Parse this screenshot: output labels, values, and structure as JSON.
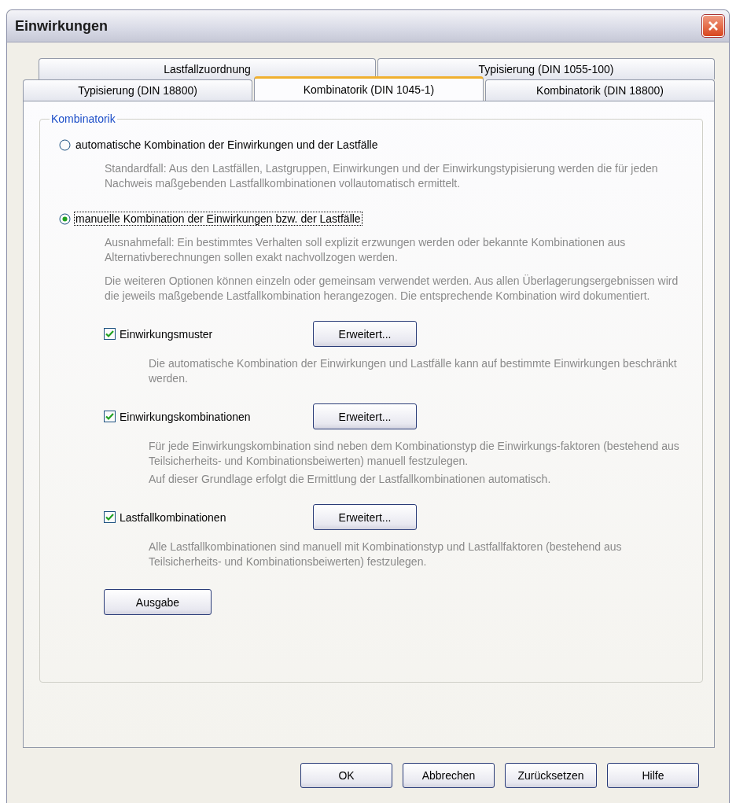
{
  "window": {
    "title": "Einwirkungen"
  },
  "tabs": [
    [
      {
        "label": "Lastfallzuordnung",
        "selected": false
      },
      {
        "label": "Typisierung (DIN 1055-100)",
        "selected": false
      }
    ],
    [
      {
        "label": "Typisierung (DIN 18800)",
        "selected": false
      },
      {
        "label": "Kombinatorik (DIN 1045-1)",
        "selected": true
      },
      {
        "label": "Kombinatorik (DIN 18800)",
        "selected": false
      }
    ]
  ],
  "group": {
    "title": "Kombinatorik",
    "options": [
      {
        "label": "automatische Kombination der Einwirkungen und der Lastfälle",
        "selected": false,
        "focused": false,
        "description": [
          "Standardfall: Aus den Lastfällen, Lastgruppen, Einwirkungen und der Einwirkungstypisierung werden die für jeden Nachweis maßgebenden Lastfallkombinationen vollautomatisch ermittelt."
        ]
      },
      {
        "label": "manuelle Kombination der Einwirkungen bzw. der Lastfälle",
        "selected": true,
        "focused": true,
        "description": [
          "Ausnahmefall: Ein bestimmtes Verhalten soll explizit erzwungen werden oder bekannte Kombinationen aus Alternativberechnungen sollen exakt nachvollzogen werden.",
          "Die weiteren Optionen können einzeln oder gemeinsam verwendet werden. Aus allen Überlagerungsergebnissen wird die jeweils maßgebende Lastfallkombination herangezogen. Die entsprechende Kombination wird dokumentiert."
        ],
        "checkboxes": [
          {
            "label": "Einwirkungsmuster",
            "checked": true,
            "button": "Erweitert...",
            "description": [
              "Die automatische Kombination der Einwirkungen und Lastfälle kann auf bestimmte Einwirkungen beschränkt werden."
            ]
          },
          {
            "label": "Einwirkungskombinationen",
            "checked": true,
            "button": "Erweitert...",
            "description": [
              "Für jede Einwirkungskombination sind neben dem Kombinationstyp die Einwirkungs-faktoren (bestehend aus Teilsicherheits- und Kombinationsbeiwerten) manuell festzulegen.",
              "Auf dieser Grundlage erfolgt die Ermittlung der Lastfallkombinationen automatisch."
            ]
          },
          {
            "label": "Lastfallkombinationen",
            "checked": true,
            "button": "Erweitert...",
            "description": [
              "Alle Lastfallkombinationen sind manuell mit Kombinationstyp und Lastfallfaktoren (bestehend aus Teilsicherheits- und Kombinationsbeiwerten) festzulegen."
            ]
          }
        ],
        "output_button": "Ausgabe"
      }
    ]
  },
  "buttons": [
    "OK",
    "Abbrechen",
    "Zurücksetzen",
    "Hilfe"
  ]
}
